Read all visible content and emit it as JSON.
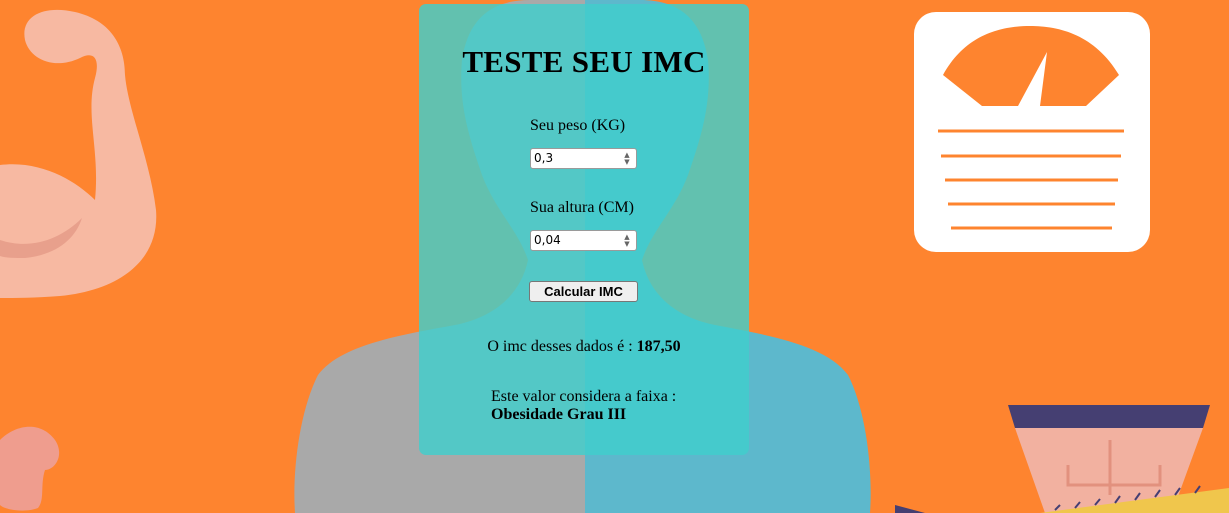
{
  "colors": {
    "background": "#fe842f",
    "card": "#40cecc",
    "scale_card": "#ffffff",
    "scale_accent": "#fe842f"
  },
  "form": {
    "title": "TESTE SEU IMC",
    "weight_label": "Seu peso (KG)",
    "weight_value": "0,3",
    "height_label": "Sua altura (CM)",
    "height_value": "0,04",
    "calculate_label": "Calcular IMC"
  },
  "result": {
    "text": "O imc desses dados é : ",
    "value": "187,50",
    "range_text": "Este valor considera a faixa :",
    "range_value": "Obesidade Grau III"
  },
  "icons": {
    "spinner_up": "▲",
    "spinner_down": "▼",
    "decor": [
      "flexed-arm-icon",
      "person-silhouette-icon",
      "bathroom-scale-icon",
      "waist-measuring-tape-icon"
    ]
  }
}
